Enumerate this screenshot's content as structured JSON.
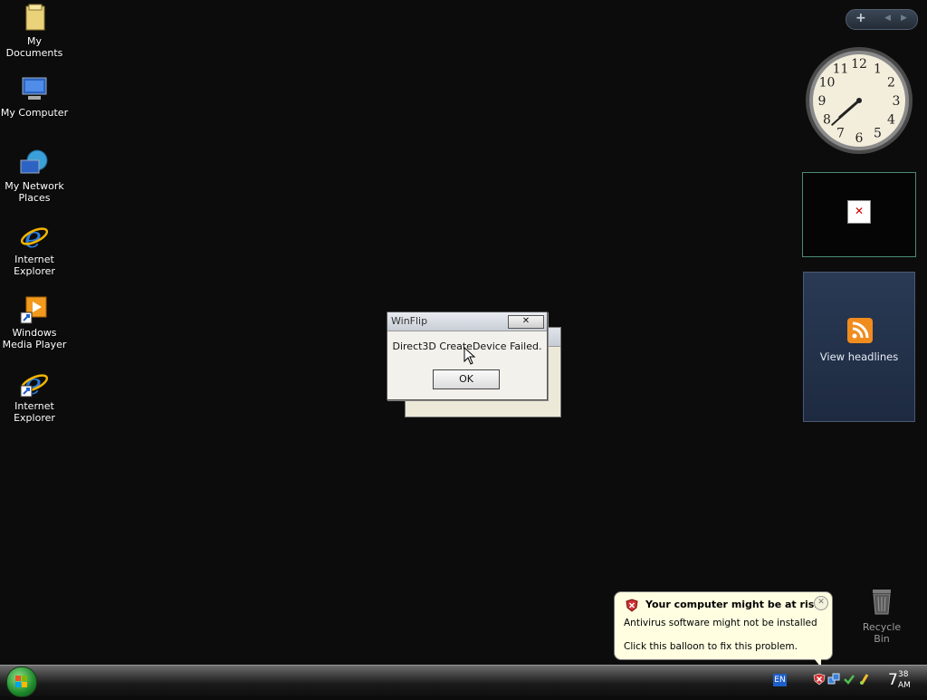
{
  "desktop": {
    "icons": [
      {
        "label": "My Documents"
      },
      {
        "label": "My Computer"
      },
      {
        "label": "My Network Places"
      },
      {
        "label": "Internet Explorer"
      },
      {
        "label": "Windows Media Player"
      },
      {
        "label": "Internet Explorer"
      }
    ],
    "recycle_bin": {
      "label": "Recycle Bin"
    }
  },
  "sidebar": {
    "controls": {
      "add": "+",
      "prev": "◀",
      "next": "▶"
    },
    "clock": {
      "numbers": [
        "12",
        "1",
        "2",
        "3",
        "4",
        "5",
        "6",
        "7",
        "8",
        "9",
        "10",
        "11"
      ],
      "hour": 7,
      "minute": 38
    },
    "broken_image_glyph": "✕",
    "feed_gadget": {
      "label": "View headlines"
    }
  },
  "dialog": {
    "title": "WinFlip",
    "close_glyph": "✕",
    "message": "Direct3D CreateDevice Failed.",
    "ok_label": "OK"
  },
  "balloon": {
    "title": "Your computer might be at risk",
    "line1": "Antivirus software might not be installed",
    "line2": "Click this balloon to fix this problem.",
    "close_glyph": "✕"
  },
  "taskbar": {
    "language": "EN",
    "clock": {
      "hour": "7",
      "minute": "38",
      "ampm": "AM"
    }
  },
  "colors": {
    "desktop_bg": "#0c0c0c",
    "balloon_bg": "#fffee1",
    "accent_green": "#1e8a2b"
  }
}
